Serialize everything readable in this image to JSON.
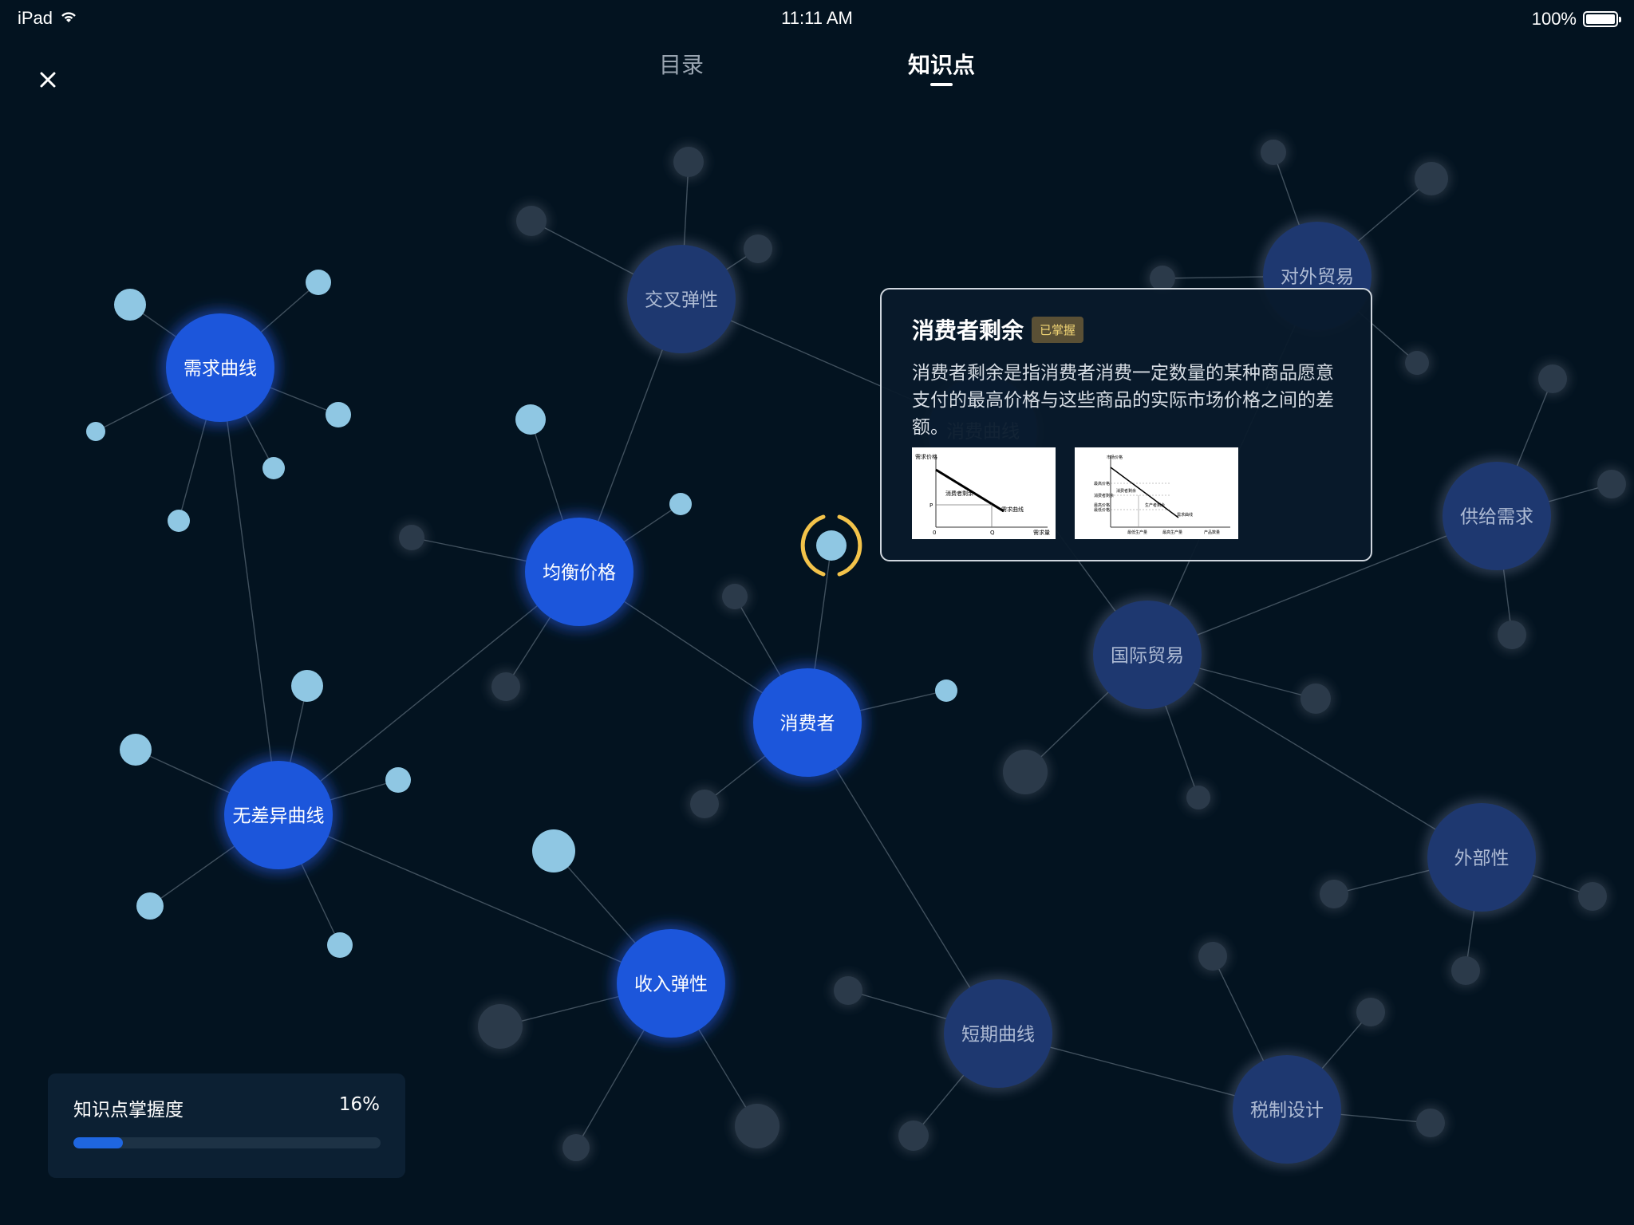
{
  "status_bar": {
    "device": "iPad",
    "time": "11:11 AM",
    "battery": "100%"
  },
  "tabs": [
    {
      "label": "目录",
      "active": false
    },
    {
      "label": "知识点",
      "active": true
    }
  ],
  "graph": {
    "main_nodes": [
      {
        "id": "demand",
        "label": "需求曲线"
      },
      {
        "id": "equil",
        "label": "均衡价格"
      },
      {
        "id": "indiff",
        "label": "无差异曲线"
      },
      {
        "id": "consumer",
        "label": "消费者"
      },
      {
        "id": "income",
        "label": "收入弹性"
      }
    ],
    "dim_nodes": [
      {
        "id": "cross",
        "label": "交叉弹性"
      },
      {
        "id": "foreign",
        "label": "对外贸易"
      },
      {
        "id": "supply",
        "label": "供给需求"
      },
      {
        "id": "intl",
        "label": "国际贸易"
      },
      {
        "id": "extern",
        "label": "外部性"
      },
      {
        "id": "short",
        "label": "短期曲线"
      },
      {
        "id": "tax",
        "label": "税制设计"
      },
      {
        "id": "consume_curve",
        "label": "消费曲线"
      }
    ]
  },
  "popup": {
    "title": "消费者剩余",
    "badge": "已掌握",
    "description": "消费者剩余是指消费者消费一定数量的某种商品愿意支付的最高价格与这些商品的实际市场价格之间的差额。",
    "thumb1": {
      "ylabel": "需求价格",
      "area": "消费者剩余",
      "curve": "需求曲线",
      "p": "P",
      "origin": "0",
      "q": "Q",
      "xlabel": "需求量"
    },
    "thumb2": {
      "ylabel": "市场价格",
      "rows": [
        "最高价格",
        "消费者剩余",
        "最高价格",
        "最低价格"
      ],
      "areas": [
        "消费者剩余",
        "生产者剩余"
      ],
      "curve": "需求曲线",
      "xlabels": [
        "最低生产量",
        "最高生产量",
        "产品数量"
      ]
    }
  },
  "mastery": {
    "label": "知识点掌握度",
    "percent_text": "16%",
    "value": 0.16
  },
  "colors": {
    "background": "#031320",
    "main_node": "#1c56db",
    "dim_node": "#1e3870",
    "leaf_light": "#8fc7e3",
    "leaf_dim": "#2b3a4a",
    "highlight_ring": "#f3c34a",
    "progress": "#1f66e0"
  }
}
